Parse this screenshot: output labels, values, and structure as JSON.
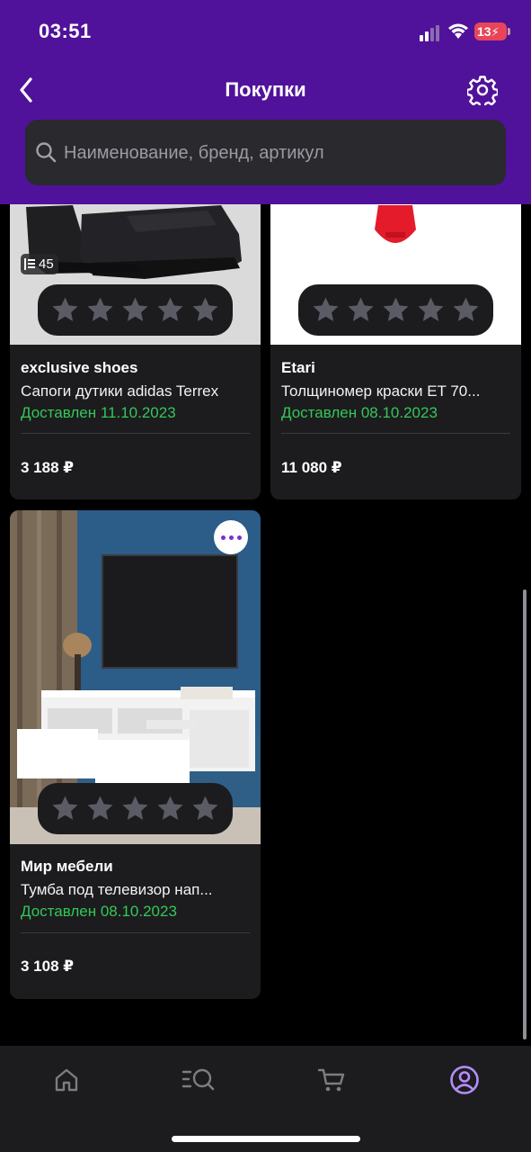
{
  "status_bar": {
    "time": "03:51",
    "battery": "13"
  },
  "header": {
    "title": "Покупки"
  },
  "search": {
    "placeholder": "Наименование, бренд, артикул"
  },
  "items": [
    {
      "brand": "exclusive shoes",
      "name": "Сапоги дутики adidas Terrex",
      "status": "Доставлен 11.10.2023",
      "price": "3 188 ₽",
      "review_count": "45",
      "rating": 0,
      "status_color": "#34c759"
    },
    {
      "brand": "Etari",
      "name": "Толщиномер краски ET 70...",
      "status": "Доставлен 08.10.2023",
      "price": "11 080 ₽",
      "rating": 0,
      "status_color": "#34c759"
    },
    {
      "brand": "Мир мебели",
      "name": "Тумба под телевизор нап...",
      "status": "Доставлен 08.10.2023",
      "price": "3 108 ₽",
      "rating": 0,
      "status_color": "#34c759"
    }
  ],
  "tabbar": {
    "tabs": [
      {
        "icon": "home-icon",
        "active": false
      },
      {
        "icon": "catalog-search-icon",
        "active": false
      },
      {
        "icon": "cart-icon",
        "active": false
      },
      {
        "icon": "profile-icon",
        "active": true
      }
    ]
  },
  "colors": {
    "header_bg": "#50129a",
    "accent": "#7b2fd1",
    "active_tab": "#b78cff",
    "delivered": "#34c759"
  }
}
